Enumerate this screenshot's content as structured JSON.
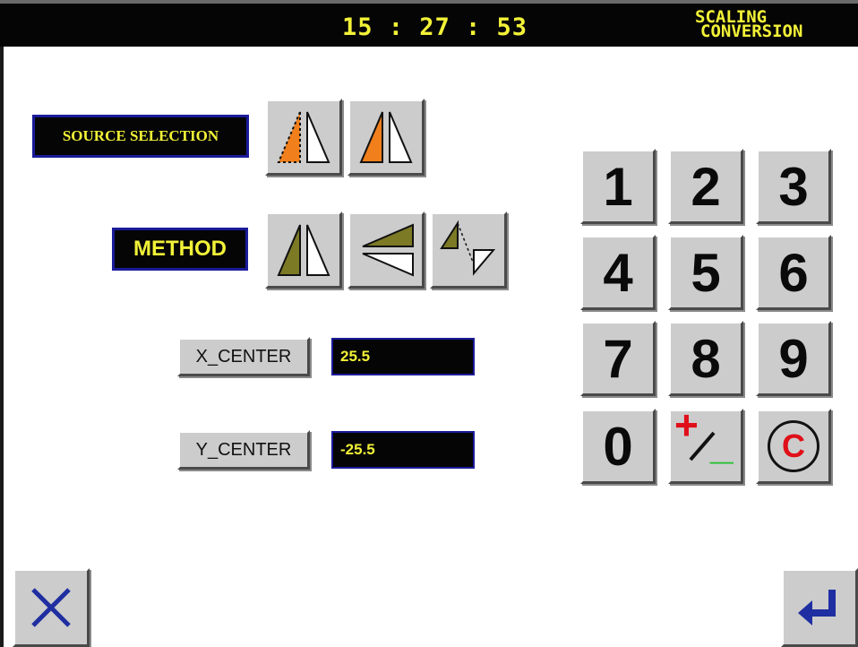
{
  "header": {
    "time": "15 : 27 : 53",
    "title_line1": "SCALING",
    "title_line2": "CONVERSION"
  },
  "source_selection": {
    "label": "SOURCE SELECTION",
    "options": [
      {
        "icon": "triangle-dotted-mirror-icon"
      },
      {
        "icon": "triangle-solid-mirror-icon"
      }
    ]
  },
  "method": {
    "label": "METHOD",
    "options": [
      {
        "icon": "mirror-horizontal-icon"
      },
      {
        "icon": "mirror-vertical-icon"
      },
      {
        "icon": "mirror-diagonal-icon"
      }
    ]
  },
  "x_center": {
    "button_label": "X_CENTER",
    "value": "25.5"
  },
  "y_center": {
    "button_label": "Y_CENTER",
    "value": "-25.5"
  },
  "keypad": {
    "keys": [
      "1",
      "2",
      "3",
      "4",
      "5",
      "6",
      "7",
      "8",
      "9",
      "0"
    ],
    "sign_key_plus": "+",
    "sign_key_minus": "_",
    "clear_key": "C"
  },
  "colors": {
    "accent_yellow": "#f2f238",
    "orange_fill": "#f07f1c",
    "olive_fill": "#7d7a26",
    "clear_red": "#e0101a",
    "plus_red": "#e0101a",
    "minus_green": "#22c02a",
    "nav_blue": "#1f2ea0"
  },
  "footer": {
    "cancel_icon": "close-icon",
    "enter_icon": "enter-return-icon"
  }
}
